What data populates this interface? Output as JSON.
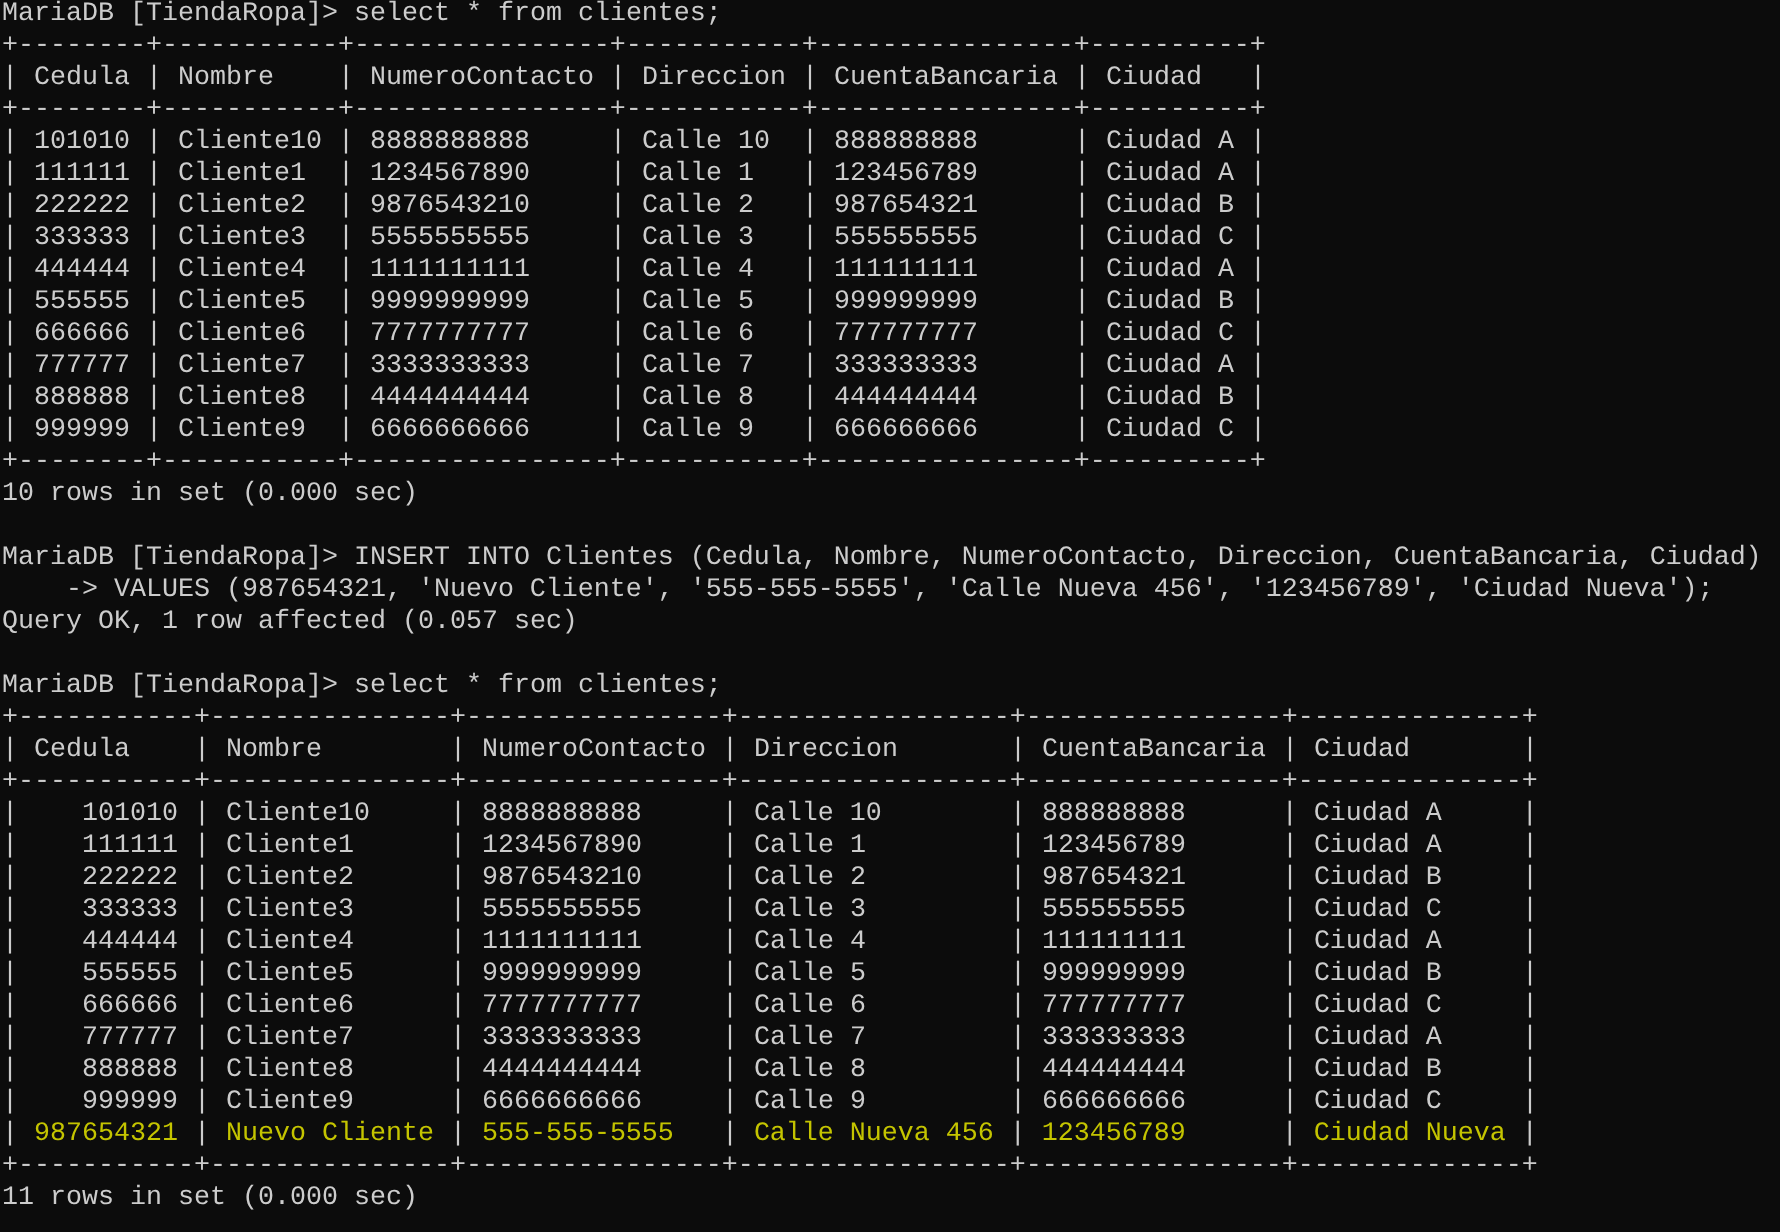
{
  "terminal": {
    "border": {
      "vertical": "|"
    },
    "blocks": [
      {
        "kind": "prompt",
        "prompt": "MariaDB [TiendaRopa]>",
        "command": "select * from clientes;"
      },
      {
        "kind": "table",
        "top_border": "+--------+-----------+----------------+-----------+----------------+----------+",
        "header_rule": "+--------+-----------+----------------+-----------+----------------+----------+",
        "bottom_border": "+--------+-----------+----------------+-----------+----------------+----------+",
        "columns": [
          {
            "name": "Cedula"
          },
          {
            "name": "Nombre"
          },
          {
            "name": "NumeroContacto"
          },
          {
            "name": "Direccion"
          },
          {
            "name": "CuentaBancaria"
          },
          {
            "name": "Ciudad"
          }
        ],
        "rows": [
          {
            "cells": [
              "101010",
              "Cliente10",
              "8888888888",
              "Calle 10",
              "888888888",
              "Ciudad A"
            ],
            "highlighted": false
          },
          {
            "cells": [
              "111111",
              "Cliente1",
              "1234567890",
              "Calle 1",
              "123456789",
              "Ciudad A"
            ],
            "highlighted": false
          },
          {
            "cells": [
              "222222",
              "Cliente2",
              "9876543210",
              "Calle 2",
              "987654321",
              "Ciudad B"
            ],
            "highlighted": false
          },
          {
            "cells": [
              "333333",
              "Cliente3",
              "5555555555",
              "Calle 3",
              "555555555",
              "Ciudad C"
            ],
            "highlighted": false
          },
          {
            "cells": [
              "444444",
              "Cliente4",
              "1111111111",
              "Calle 4",
              "111111111",
              "Ciudad A"
            ],
            "highlighted": false
          },
          {
            "cells": [
              "555555",
              "Cliente5",
              "9999999999",
              "Calle 5",
              "999999999",
              "Ciudad B"
            ],
            "highlighted": false
          },
          {
            "cells": [
              "666666",
              "Cliente6",
              "7777777777",
              "Calle 6",
              "777777777",
              "Ciudad C"
            ],
            "highlighted": false
          },
          {
            "cells": [
              "777777",
              "Cliente7",
              "3333333333",
              "Calle 7",
              "333333333",
              "Ciudad A"
            ],
            "highlighted": false
          },
          {
            "cells": [
              "888888",
              "Cliente8",
              "4444444444",
              "Calle 8",
              "444444444",
              "Ciudad B"
            ],
            "highlighted": false
          },
          {
            "cells": [
              "999999",
              "Cliente9",
              "6666666666",
              "Calle 9",
              "666666666",
              "Ciudad C"
            ],
            "highlighted": false
          }
        ]
      },
      {
        "kind": "output",
        "text": "10 rows in set (0.000 sec)"
      },
      {
        "kind": "blank"
      },
      {
        "kind": "prompt",
        "prompt": "MariaDB [TiendaRopa]>",
        "command": "INSERT INTO Clientes (Cedula, Nombre, NumeroContacto, Direccion, CuentaBancaria, Ciudad)"
      },
      {
        "kind": "continuation",
        "prompt": "->",
        "command": "VALUES (987654321, 'Nuevo Cliente', '555-555-5555', 'Calle Nueva 456', '123456789', 'Ciudad Nueva');"
      },
      {
        "kind": "output",
        "text": "Query OK, 1 row affected (0.057 sec)"
      },
      {
        "kind": "blank"
      },
      {
        "kind": "prompt",
        "prompt": "MariaDB [TiendaRopa]>",
        "command": "select * from clientes;"
      },
      {
        "kind": "table",
        "top_border": "+-----------+---------------+----------------+-----------------+----------------+--------------+",
        "header_rule": "+-----------+---------------+----------------+-----------------+----------------+--------------+",
        "bottom_border": "+-----------+---------------+----------------+-----------------+----------------+--------------+",
        "first_column_right_aligned": true,
        "columns": [
          {
            "name": "Cedula"
          },
          {
            "name": "Nombre"
          },
          {
            "name": "NumeroContacto"
          },
          {
            "name": "Direccion"
          },
          {
            "name": "CuentaBancaria"
          },
          {
            "name": "Ciudad"
          }
        ],
        "rows": [
          {
            "cells": [
              "101010",
              "Cliente10",
              "8888888888",
              "Calle 10",
              "888888888",
              "Ciudad A"
            ],
            "highlighted": false
          },
          {
            "cells": [
              "111111",
              "Cliente1",
              "1234567890",
              "Calle 1",
              "123456789",
              "Ciudad A"
            ],
            "highlighted": false
          },
          {
            "cells": [
              "222222",
              "Cliente2",
              "9876543210",
              "Calle 2",
              "987654321",
              "Ciudad B"
            ],
            "highlighted": false
          },
          {
            "cells": [
              "333333",
              "Cliente3",
              "5555555555",
              "Calle 3",
              "555555555",
              "Ciudad C"
            ],
            "highlighted": false
          },
          {
            "cells": [
              "444444",
              "Cliente4",
              "1111111111",
              "Calle 4",
              "111111111",
              "Ciudad A"
            ],
            "highlighted": false
          },
          {
            "cells": [
              "555555",
              "Cliente5",
              "9999999999",
              "Calle 5",
              "999999999",
              "Ciudad B"
            ],
            "highlighted": false
          },
          {
            "cells": [
              "666666",
              "Cliente6",
              "7777777777",
              "Calle 6",
              "777777777",
              "Ciudad C"
            ],
            "highlighted": false
          },
          {
            "cells": [
              "777777",
              "Cliente7",
              "3333333333",
              "Calle 7",
              "333333333",
              "Ciudad A"
            ],
            "highlighted": false
          },
          {
            "cells": [
              "888888",
              "Cliente8",
              "4444444444",
              "Calle 8",
              "444444444",
              "Ciudad B"
            ],
            "highlighted": false
          },
          {
            "cells": [
              "999999",
              "Cliente9",
              "6666666666",
              "Calle 9",
              "666666666",
              "Ciudad C"
            ],
            "highlighted": false
          },
          {
            "cells": [
              "987654321",
              "Nuevo Cliente",
              "555-555-5555",
              "Calle Nueva 456",
              "123456789",
              "Ciudad Nueva"
            ],
            "highlighted": true
          }
        ]
      },
      {
        "kind": "output",
        "text": "11 rows in set (0.000 sec)"
      }
    ]
  }
}
